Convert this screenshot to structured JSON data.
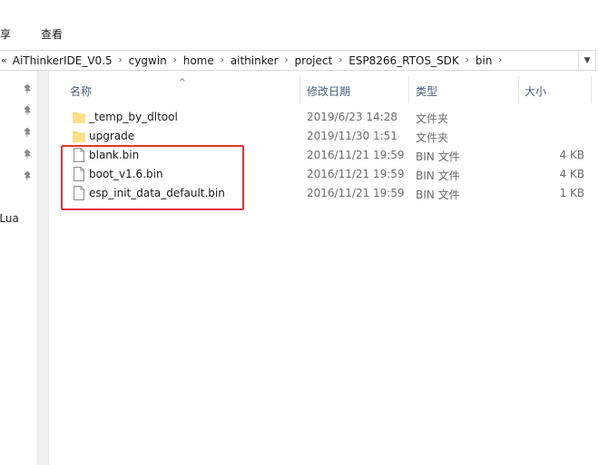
{
  "ribbon": {
    "tab_share": "共享",
    "tab_view": "查看"
  },
  "address": {
    "overflow": "«",
    "crumbs": [
      "AiThinkerIDE_V0.5",
      "cygwin",
      "home",
      "aithinker",
      "project",
      "ESP8266_RTOS_SDK",
      "bin"
    ]
  },
  "nav": {
    "partial_item": "eLua"
  },
  "columns": {
    "name": "名称",
    "date": "修改日期",
    "type": "类型",
    "size": "大小"
  },
  "files": [
    {
      "name": "_temp_by_dltool",
      "date": "2019/6/23 14:28",
      "type": "文件夹",
      "size": "",
      "icon": "folder-icon"
    },
    {
      "name": "upgrade",
      "date": "2019/11/30 1:51",
      "type": "文件夹",
      "size": "",
      "icon": "folder-icon"
    },
    {
      "name": "blank.bin",
      "date": "2016/11/21 19:59",
      "type": "BIN 文件",
      "size": "4 KB",
      "icon": "file-icon"
    },
    {
      "name": "boot_v1.6.bin",
      "date": "2016/11/21 19:59",
      "type": "BIN 文件",
      "size": "4 KB",
      "icon": "file-icon"
    },
    {
      "name": "esp_init_data_default.bin",
      "date": "2016/11/21 19:59",
      "type": "BIN 文件",
      "size": "1 KB",
      "icon": "file-icon"
    }
  ],
  "colors": {
    "highlight": "#e0343a",
    "folder": "#f8d775",
    "header_text": "#4c607a"
  }
}
